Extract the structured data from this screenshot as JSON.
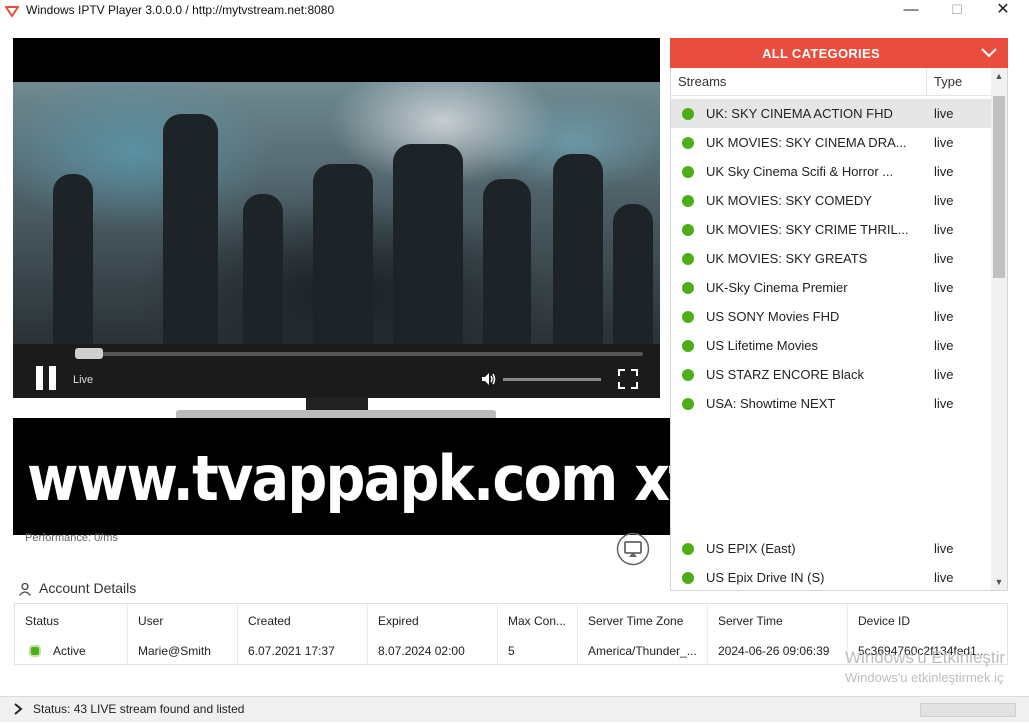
{
  "window": {
    "title": "Windows IPTV Player 3.0.0.0 / http://mytvstream.net:8080",
    "minimize_glyph": "—",
    "maximize_glyph": "☐",
    "close_glyph": "✕",
    "accent_color": "#e94d3e"
  },
  "player": {
    "live_label": "Live",
    "performance": "Performance: 0/ms",
    "icons": [
      "pause-icon",
      "volume-icon",
      "fullscreen-icon",
      "cast-icon"
    ]
  },
  "banner": {
    "text": "www.tvappapk.com xtream codes"
  },
  "categories": {
    "title": "ALL CATEGORIES",
    "columns": {
      "streams": "Streams",
      "type": "Type"
    },
    "streams": [
      {
        "name": "UK: SKY CINEMA ACTION FHD",
        "type": "live"
      },
      {
        "name": "UK MOVIES: SKY CINEMA DRA...",
        "type": "live"
      },
      {
        "name": "UK Sky Cinema Scifi & Horror ...",
        "type": "live"
      },
      {
        "name": "UK MOVIES: SKY COMEDY",
        "type": "live"
      },
      {
        "name": "UK MOVIES: SKY CRIME THRIL...",
        "type": "live"
      },
      {
        "name": "UK MOVIES: SKY GREATS",
        "type": "live"
      },
      {
        "name": "UK-Sky Cinema Premier",
        "type": "live"
      },
      {
        "name": "US SONY Movies FHD",
        "type": "live"
      },
      {
        "name": "US Lifetime Movies",
        "type": "live"
      },
      {
        "name": "US STARZ ENCORE Black",
        "type": "live"
      },
      {
        "name": "USA:  Showtime NEXT",
        "type": "live"
      },
      {
        "name": "US EPIX (East)",
        "type": "live"
      },
      {
        "name": "US Epix Drive IN (S)",
        "type": "live"
      }
    ]
  },
  "account": {
    "title": "Account Details",
    "headers": [
      "Status",
      "User",
      "Created",
      "Expired",
      "Max Con...",
      "Server Time Zone",
      "Server Time",
      "Device ID"
    ],
    "values": [
      "Active",
      "Marie@Smith",
      "6.07.2021 17:37",
      "8.07.2024 02:00",
      "5",
      "America/Thunder_...",
      "2024-06-26 09:06:39",
      "5c3694760c2f134fed1..."
    ]
  },
  "watermark": {
    "line1": "Windows'u Etkinleştir",
    "line2": "Windows'u etkinleştirmek iç"
  },
  "statusbar": {
    "text": "Status: 43 LIVE stream found and listed"
  }
}
